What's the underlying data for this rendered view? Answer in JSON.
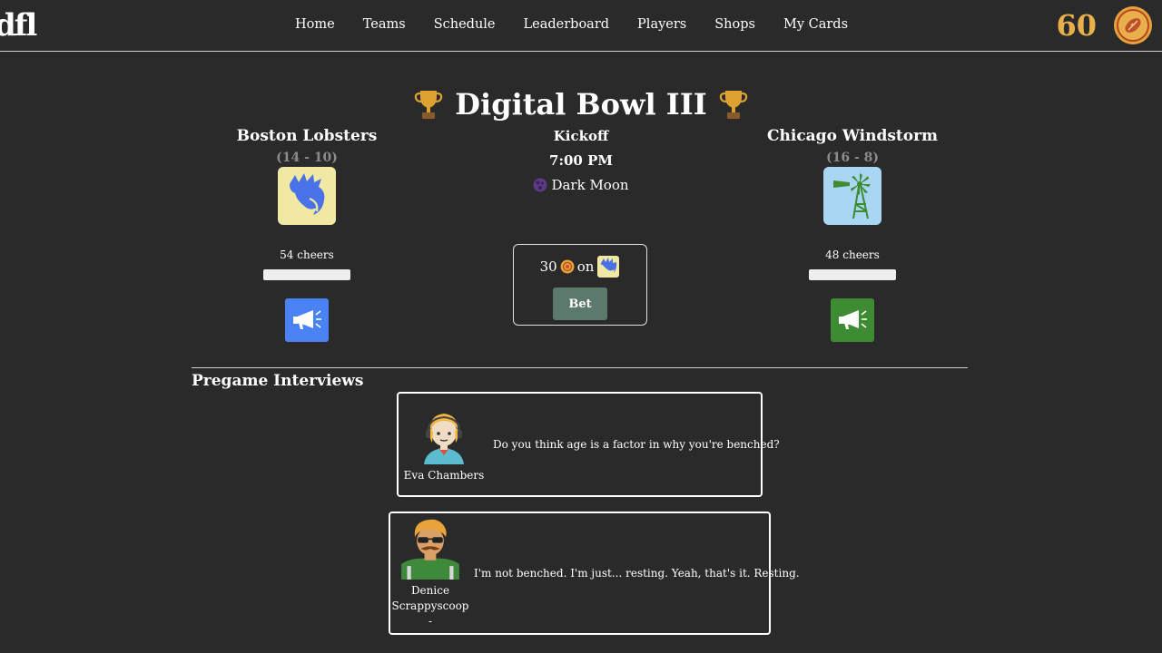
{
  "header": {
    "logo": "dfl",
    "nav": [
      "Home",
      "Teams",
      "Schedule",
      "Leaderboard",
      "Players",
      "Shops",
      "My Cards"
    ],
    "coins": "60"
  },
  "game": {
    "title": "Digital Bowl III",
    "kickoff_label": "Kickoff",
    "kickoff_time": "7:00 PM",
    "weather": "Dark Moon"
  },
  "home": {
    "name": "Boston Lobsters",
    "record": "(14 - 10)",
    "cheers": "54 cheers",
    "color": "#4a82f3"
  },
  "away": {
    "name": "Chicago Windstorm",
    "record": "(16 - 8)",
    "cheers": "48 cheers",
    "color": "#3d8b32"
  },
  "bet": {
    "amount": "30",
    "on_label": "on",
    "button": "Bet"
  },
  "interviews": {
    "title": "Pregame Interviews",
    "items": [
      {
        "name": "Eva Chambers",
        "quote": "Do you think age is a factor in why you're benched?"
      },
      {
        "name": "Denice Scrappyscoop",
        "suffix": "-",
        "quote": "I'm not benched. I'm just... resting. Yeah, that's it. Resting."
      }
    ]
  },
  "colors": {
    "background": "#2a2a2a",
    "accent_gold": "#e8b04c",
    "muted": "#8c8c8c"
  }
}
